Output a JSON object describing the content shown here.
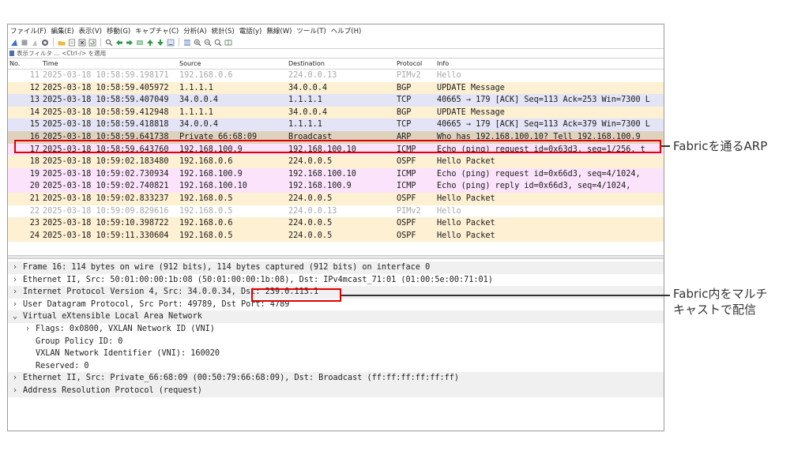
{
  "menu": [
    "ファイル(F)",
    "編集(E)",
    "表示(V)",
    "移動(G)",
    "キャプチャ(C)",
    "分析(A)",
    "統計(S)",
    "電話(y)",
    "無線(W)",
    "ツール(T)",
    "ヘルプ(H)"
  ],
  "filter": {
    "placeholder": "表示フィルタ … <Ctrl-/> を適用"
  },
  "columns": {
    "no": "No.",
    "time": "Time",
    "source": "Source",
    "destination": "Destination",
    "protocol": "Protocol",
    "info": "Info"
  },
  "packets": [
    {
      "no": "11",
      "time": "2025-03-18 10:58:59.198171",
      "src": "192.168.0.6",
      "dst": "224.0.0.13",
      "proto": "PIMv2",
      "info": "Hello",
      "bg": "#ffffff",
      "fg": "#a8a8a8"
    },
    {
      "no": "12",
      "time": "2025-03-18 10:58:59.405972",
      "src": "1.1.1.1",
      "dst": "34.0.0.4",
      "proto": "BGP",
      "info": "UPDATE Message",
      "bg": "#fdf0d3",
      "fg": "#1a1a1a"
    },
    {
      "no": "13",
      "time": "2025-03-18 10:58:59.407049",
      "src": "34.0.0.4",
      "dst": "1.1.1.1",
      "proto": "TCP",
      "info": "40665 → 179 [ACK] Seq=113 Ack=253 Win=7300 L",
      "bg": "#e4e4f7",
      "fg": "#1a1a1a"
    },
    {
      "no": "14",
      "time": "2025-03-18 10:58:59.412948",
      "src": "1.1.1.1",
      "dst": "34.0.0.4",
      "proto": "BGP",
      "info": "UPDATE Message",
      "bg": "#fdf0d3",
      "fg": "#1a1a1a"
    },
    {
      "no": "15",
      "time": "2025-03-18 10:58:59.418818",
      "src": "34.0.0.4",
      "dst": "1.1.1.1",
      "proto": "TCP",
      "info": "40665 → 179 [ACK] Seq=113 Ack=379 Win=7300 L",
      "bg": "#e4e4f7",
      "fg": "#1a1a1a"
    },
    {
      "no": "16",
      "time": "2025-03-18 10:58:59.641738",
      "src": "Private_66:68:09",
      "dst": "Broadcast",
      "proto": "ARP",
      "info": "Who has 192.168.100.10? Tell 192.168.100.9",
      "bg": "#ded2be",
      "fg": "#1a1a1a"
    },
    {
      "no": "17",
      "time": "2025-03-18 10:58:59.643760",
      "src": "192.168.100.9",
      "dst": "192.168.100.10",
      "proto": "ICMP",
      "info": "Echo (ping) request  id=0x63d3, seq=1/256, t",
      "bg": "#fbe4fb",
      "fg": "#1a1a1a"
    },
    {
      "no": "18",
      "time": "2025-03-18 10:59:02.183480",
      "src": "192.168.0.6",
      "dst": "224.0.0.5",
      "proto": "OSPF",
      "info": "Hello Packet",
      "bg": "#fdf0d3",
      "fg": "#1a1a1a"
    },
    {
      "no": "19",
      "time": "2025-03-18 10:59:02.730934",
      "src": "192.168.100.9",
      "dst": "192.168.100.10",
      "proto": "ICMP",
      "info": "Echo (ping) request  id=0x66d3, seq=4/1024,",
      "bg": "#fbe4fb",
      "fg": "#1a1a1a"
    },
    {
      "no": "20",
      "time": "2025-03-18 10:59:02.740821",
      "src": "192.168.100.10",
      "dst": "192.168.100.9",
      "proto": "ICMP",
      "info": "Echo (ping) reply    id=0x66d3, seq=4/1024,",
      "bg": "#fbe4fb",
      "fg": "#1a1a1a"
    },
    {
      "no": "21",
      "time": "2025-03-18 10:59:02.833237",
      "src": "192.168.0.5",
      "dst": "224.0.0.5",
      "proto": "OSPF",
      "info": "Hello Packet",
      "bg": "#fdf0d3",
      "fg": "#1a1a1a"
    },
    {
      "no": "22",
      "time": "2025-03-18 10:59:09.829616",
      "src": "192.168.0.5",
      "dst": "224.0.0.13",
      "proto": "PIMv2",
      "info": "Hello",
      "bg": "#ffffff",
      "fg": "#a8a8a8"
    },
    {
      "no": "23",
      "time": "2025-03-18 10:59:10.398722",
      "src": "192.168.0.6",
      "dst": "224.0.0.5",
      "proto": "OSPF",
      "info": "Hello Packet",
      "bg": "#fdf0d3",
      "fg": "#1a1a1a"
    },
    {
      "no": "24",
      "time": "2025-03-18 10:59:11.330604",
      "src": "192.168.0.5",
      "dst": "224.0.0.5",
      "proto": "OSPF",
      "info": "Hello Packet",
      "bg": "#fdf0d3",
      "fg": "#1a1a1a"
    }
  ],
  "details": [
    {
      "arrow": "›",
      "indent": 0,
      "text": "Frame 16: 114 bytes on wire (912 bits), 114 bytes captured (912 bits) on interface 0",
      "shaded": true
    },
    {
      "arrow": "›",
      "indent": 0,
      "text": "Ethernet II, Src: 50:01:00:00:1b:08 (50:01:00:00:1b:08), Dst: IPv4mcast_71:01 (01:00:5e:00:71:01)",
      "shaded": false
    },
    {
      "arrow": "›",
      "indent": 0,
      "text": "Internet Protocol Version 4, Src: 34.0.0.34, Dst: 239.0.113.1",
      "shaded": true
    },
    {
      "arrow": "›",
      "indent": 0,
      "text": "User Datagram Protocol, Src Port: 49789, Dst Port: 4789",
      "shaded": false
    },
    {
      "arrow": "⌄",
      "indent": 0,
      "text": "Virtual eXtensible Local Area Network",
      "shaded": true
    },
    {
      "arrow": "›",
      "indent": 1,
      "text": "Flags: 0x0800, VXLAN Network ID (VNI)",
      "shaded": false
    },
    {
      "arrow": "",
      "indent": 1,
      "text": "Group Policy ID: 0",
      "shaded": false
    },
    {
      "arrow": "",
      "indent": 1,
      "text": "VXLAN Network Identifier (VNI): 160020",
      "shaded": false
    },
    {
      "arrow": "",
      "indent": 1,
      "text": "Reserved: 0",
      "shaded": false
    },
    {
      "arrow": "›",
      "indent": 0,
      "text": "Ethernet II, Src: Private_66:68:09 (00:50:79:66:68:09), Dst: Broadcast (ff:ff:ff:ff:ff:ff)",
      "shaded": true
    },
    {
      "arrow": "›",
      "indent": 0,
      "text": "Address Resolution Protocol (request)",
      "shaded": true
    }
  ],
  "annotations": {
    "arp": "Fabricを通るARP",
    "multicast_line1": "Fabric内をマルチ",
    "multicast_line2": "キャストで配信"
  },
  "colors": {
    "highlight": "#e00000",
    "callout_line": "#333333"
  }
}
